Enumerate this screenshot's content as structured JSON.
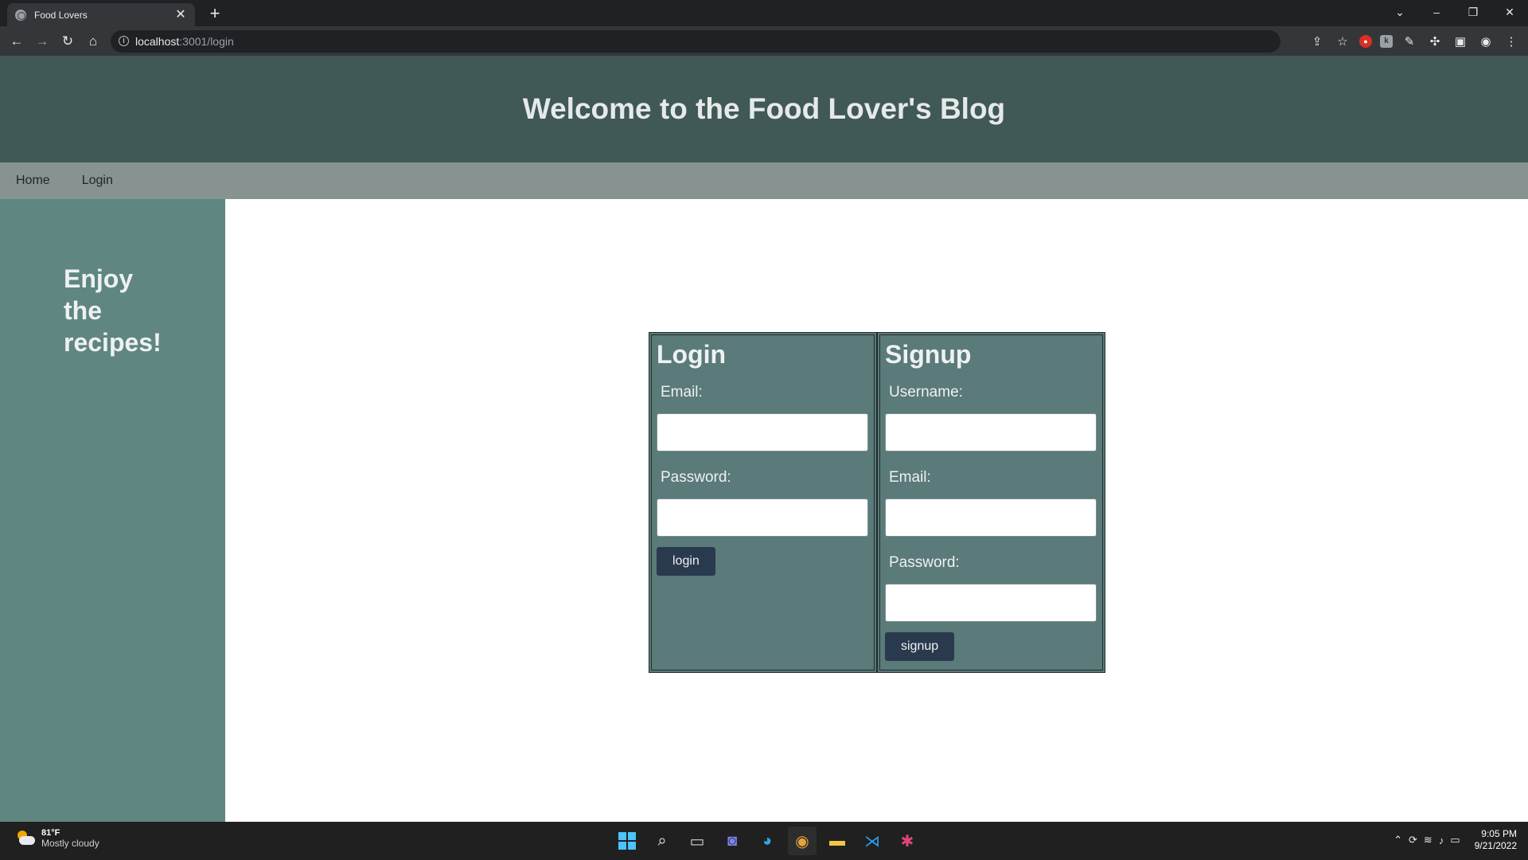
{
  "browser": {
    "tab_title": "Food Lovers",
    "tab_close": "✕",
    "new_tab": "+",
    "url_host": "localhost",
    "url_path": ":3001/login",
    "window_controls": [
      "⌄",
      "–",
      "❐",
      "✕"
    ]
  },
  "site": {
    "header_title": "Welcome to the Food Lover's Blog",
    "nav": [
      "Home",
      "Login"
    ],
    "aside_text": "Enjoy the recipes!"
  },
  "login_form": {
    "title": "Login",
    "email_label": "Email:",
    "password_label": "Password:",
    "submit_label": "login"
  },
  "signup_form": {
    "title": "Signup",
    "username_label": "Username:",
    "email_label": "Email:",
    "password_label": "Password:",
    "submit_label": "signup"
  },
  "taskbar": {
    "weather_temp": "81°F",
    "weather_condition": "Mostly cloudy",
    "time": "9:05 PM",
    "date": "9/21/2022"
  }
}
